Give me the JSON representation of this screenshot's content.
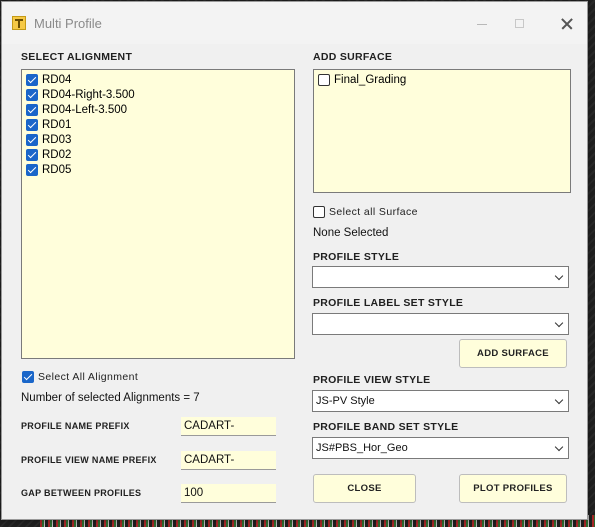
{
  "window": {
    "title": "Multi Profile"
  },
  "alignment": {
    "heading": "SELECT ALIGNMENT",
    "items": [
      {
        "label": "RD04",
        "checked": true
      },
      {
        "label": "RD04-Right-3.500",
        "checked": true
      },
      {
        "label": "RD04-Left-3.500",
        "checked": true
      },
      {
        "label": "RD01",
        "checked": true
      },
      {
        "label": "RD03",
        "checked": true
      },
      {
        "label": "RD02",
        "checked": true
      },
      {
        "label": "RD05",
        "checked": true
      }
    ],
    "select_all_label": "Select All Alignment",
    "select_all_checked": true,
    "count_text": "Number of selected Alignments = 7"
  },
  "fields": {
    "profile_name_prefix_label": "PROFILE NAME PREFIX",
    "profile_name_prefix_value": "CADART-",
    "profile_view_name_prefix_label": "PROFILE VIEW NAME PREFIX",
    "profile_view_name_prefix_value": "CADART-",
    "gap_between_profiles_label": "GAP BETWEEN PROFILES",
    "gap_between_profiles_value": "100"
  },
  "surface": {
    "heading": "ADD SURFACE",
    "items": [
      {
        "label": "Final_Grading",
        "checked": false
      }
    ],
    "select_all_label": "Select all Surface",
    "select_all_checked": false,
    "status_text": "None Selected",
    "add_button_label": "ADD SURFACE"
  },
  "styles": {
    "profile_style_label": "PROFILE STYLE",
    "profile_style_value": "",
    "profile_label_set_style_label": "PROFILE LABEL SET STYLE",
    "profile_label_set_style_value": "",
    "profile_view_style_label": "PROFILE VIEW STYLE",
    "profile_view_style_value": "JS-PV Style",
    "profile_band_set_style_label": "PROFILE BAND SET STYLE",
    "profile_band_set_style_value": "JS#PBS_Hor_Geo"
  },
  "actions": {
    "close_label": "CLOSE",
    "plot_label": "PLOT PROFILES"
  },
  "colors": {
    "list_background": "#fffedb",
    "checkbox_accent": "#1a66c9",
    "window_background": "#f0f0f0"
  }
}
